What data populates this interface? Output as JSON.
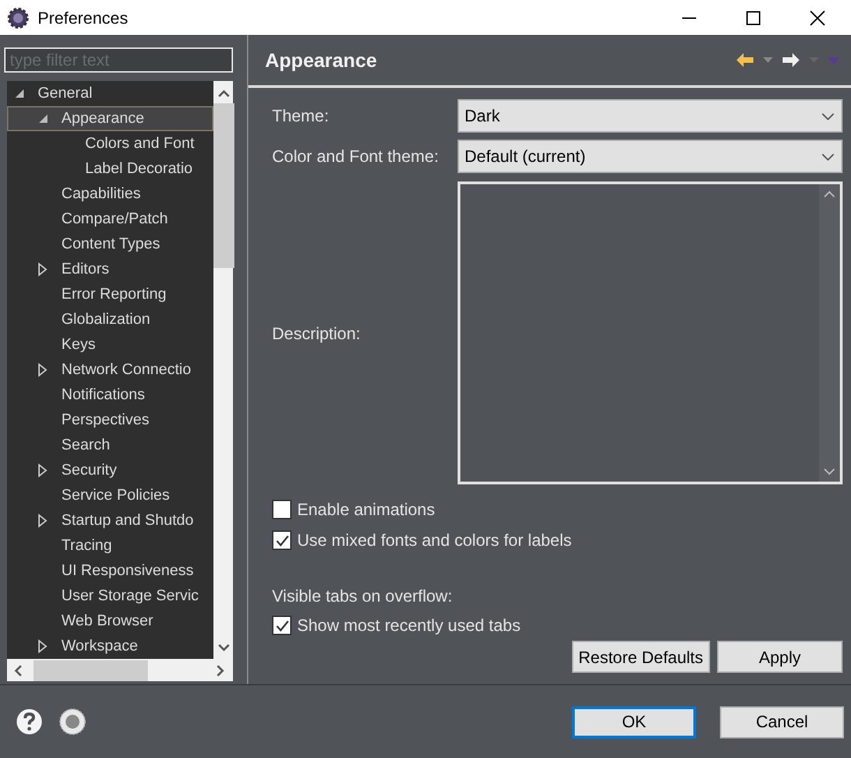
{
  "window": {
    "title": "Preferences"
  },
  "filter": {
    "placeholder": "type filter text"
  },
  "tree": [
    {
      "label": "General",
      "kind": "branch",
      "expanded": true,
      "selected": false,
      "children": [
        {
          "label": "Appearance",
          "kind": "branch",
          "expanded": true,
          "selected": true,
          "children": [
            {
              "label": "Colors and Font",
              "kind": "leaf",
              "selected": false
            },
            {
              "label": "Label Decoratio",
              "kind": "leaf",
              "selected": false
            }
          ]
        },
        {
          "label": "Capabilities",
          "kind": "leaf",
          "selected": false
        },
        {
          "label": "Compare/Patch",
          "kind": "leaf",
          "selected": false
        },
        {
          "label": "Content Types",
          "kind": "leaf",
          "selected": false
        },
        {
          "label": "Editors",
          "kind": "branch",
          "expanded": false,
          "selected": false
        },
        {
          "label": "Error Reporting",
          "kind": "leaf",
          "selected": false
        },
        {
          "label": "Globalization",
          "kind": "leaf",
          "selected": false
        },
        {
          "label": "Keys",
          "kind": "leaf",
          "selected": false
        },
        {
          "label": "Network Connectio",
          "kind": "branch",
          "expanded": false,
          "selected": false
        },
        {
          "label": "Notifications",
          "kind": "leaf",
          "selected": false
        },
        {
          "label": "Perspectives",
          "kind": "leaf",
          "selected": false
        },
        {
          "label": "Search",
          "kind": "leaf",
          "selected": false
        },
        {
          "label": "Security",
          "kind": "branch",
          "expanded": false,
          "selected": false
        },
        {
          "label": "Service Policies",
          "kind": "leaf",
          "selected": false
        },
        {
          "label": "Startup and Shutdo",
          "kind": "branch",
          "expanded": false,
          "selected": false
        },
        {
          "label": "Tracing",
          "kind": "leaf",
          "selected": false
        },
        {
          "label": "UI Responsiveness",
          "kind": "leaf",
          "selected": false
        },
        {
          "label": "User Storage Servic",
          "kind": "leaf",
          "selected": false
        },
        {
          "label": "Web Browser",
          "kind": "leaf",
          "selected": false
        },
        {
          "label": "Workspace",
          "kind": "branch",
          "expanded": false,
          "selected": false
        }
      ]
    }
  ],
  "page": {
    "title": "Appearance",
    "fields": [
      {
        "label": "Theme:",
        "value": "Dark"
      },
      {
        "label": "Color and Font theme:",
        "value": "Default (current)"
      }
    ],
    "description_label": "Description:",
    "checkboxes": [
      {
        "label": "Enable animations",
        "checked": false
      },
      {
        "label": "Use mixed fonts and colors for labels",
        "checked": true
      }
    ],
    "overflow_label": "Visible tabs on overflow:",
    "overflow_checkboxes": [
      {
        "label": "Show most recently used tabs",
        "checked": true
      }
    ],
    "buttons": [
      "Restore Defaults",
      "Apply"
    ]
  },
  "footer_buttons": [
    {
      "label": "OK",
      "focused": true
    },
    {
      "label": "Cancel",
      "focused": false
    }
  ]
}
